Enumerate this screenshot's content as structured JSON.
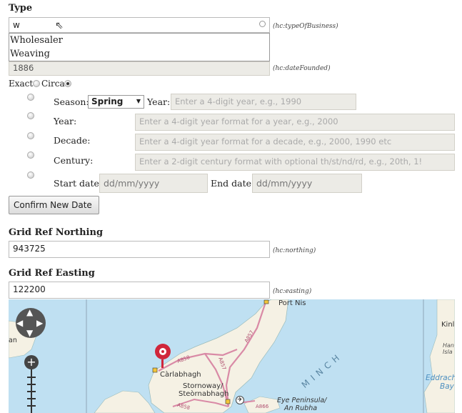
{
  "type_field": {
    "label": "Type",
    "value": "w",
    "hint": "(hc:typeOfBusiness)",
    "suggestions": [
      "Wholesaler",
      "Weaving"
    ]
  },
  "date_founded": {
    "value": "1886",
    "hint": "(hc:dateFounded)"
  },
  "date_mode": {
    "exact_label": "Exact",
    "circa_label": "Circa",
    "selected": "Circa"
  },
  "season_row": {
    "label": "Season:",
    "selected_season": "Spring",
    "year_label": "Year:",
    "year_placeholder": "Enter a 4-digit year, e.g., 1990"
  },
  "year_row": {
    "label": "Year:",
    "placeholder": "Enter a 4-digit year format for a year, e.g., 2000"
  },
  "decade_row": {
    "label": "Decade:",
    "placeholder": "Enter a 4-digit year format for a decade, e.g., 2000, 1990 etc"
  },
  "century_row": {
    "label": "Century:",
    "placeholder": "Enter a 2-digit century format with optional th/st/nd/rd, e.g., 20th, 1!"
  },
  "range_row": {
    "start_label": "Start date:",
    "start_placeholder": "dd/mm/yyyy",
    "end_label": "End date:",
    "end_placeholder": "dd/mm/yyyy"
  },
  "confirm_button": "Confirm New Date",
  "northing": {
    "label": "Grid Ref Northing",
    "value": "943725",
    "hint": "(hc:northing)"
  },
  "easting": {
    "label": "Grid Ref Easting",
    "value": "122200",
    "hint": "(hc:easting)"
  },
  "map": {
    "labels": {
      "port_nis": "Port Nis",
      "kinl": "Kinl",
      "an": "an",
      "harris_isle": "Han\nIsla",
      "a857_1": "A857",
      "a857_2": "A857",
      "a858_1": "A858",
      "a858_2": "A858",
      "a866": "A866",
      "carlabhagh": "Càrlabhagh",
      "stornoway": "Stornoway/",
      "steornabhagh": "Steòrnabhagh",
      "minch": "MINCH",
      "eddrach": "Eddrach",
      "bay": "Bay",
      "eye_peninsula": "Eye Peninsula/",
      "an_rubha": "An Rubha"
    },
    "colors": {
      "sea": "#bfe0f2",
      "land": "#f5f1e4",
      "road": "#d98aa6",
      "marker": "#d0263b"
    }
  }
}
